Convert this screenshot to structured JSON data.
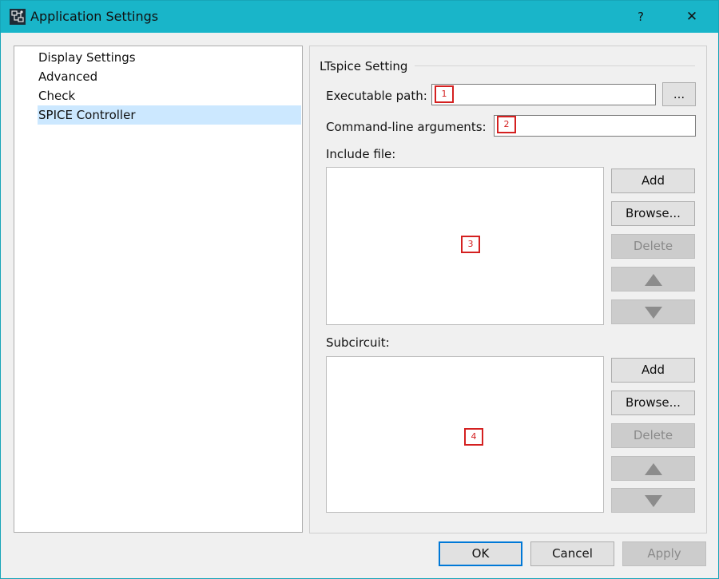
{
  "window": {
    "title": "Application Settings",
    "help_label": "?",
    "close_label": "✕"
  },
  "sidebar": {
    "items": [
      {
        "label": "Display Settings",
        "selected": false
      },
      {
        "label": "Advanced",
        "selected": false
      },
      {
        "label": "Check",
        "selected": false
      },
      {
        "label": "SPICE Controller",
        "selected": true
      }
    ]
  },
  "ltspice": {
    "group_title": "LTspice Setting",
    "executable_label": "Executable path:",
    "executable_value": "",
    "browse_dots_label": "...",
    "args_label": "Command-line arguments:",
    "args_value": "",
    "include_label": "Include file:",
    "subcircuit_label": "Subcircuit:"
  },
  "markers": [
    "1",
    "2",
    "3",
    "4"
  ],
  "include_buttons": {
    "add": "Add",
    "browse": "Browse...",
    "delete": "Delete"
  },
  "subcircuit_buttons": {
    "add": "Add",
    "browse": "Browse...",
    "delete": "Delete"
  },
  "footer": {
    "ok": "OK",
    "cancel": "Cancel",
    "apply": "Apply"
  },
  "colors": {
    "titlebar": "#19b5c9",
    "selection": "#cce8ff",
    "marker": "#d42020"
  }
}
